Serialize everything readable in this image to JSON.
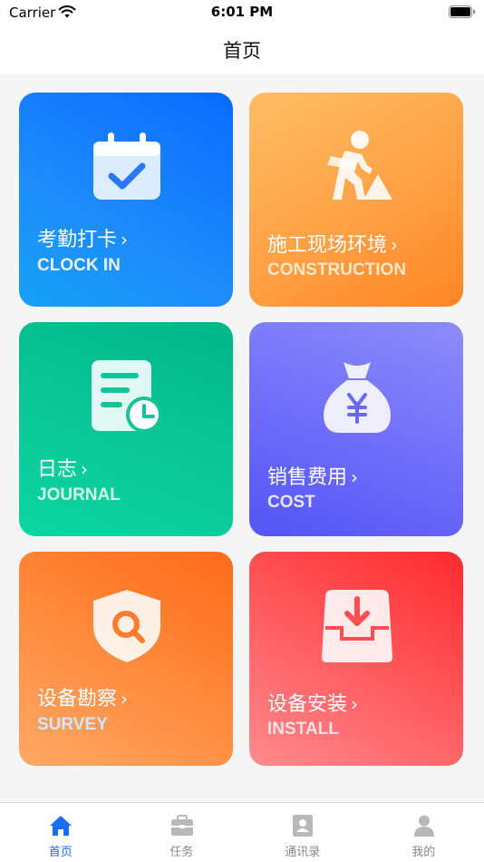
{
  "status_bar": {
    "carrier": "Carrier",
    "time": "6:01 PM",
    "icons": [
      "wifi-icon",
      "battery-icon"
    ]
  },
  "nav": {
    "title": "首页"
  },
  "cards": [
    {
      "title": "考勤打卡",
      "chevron": "›",
      "subtitle": "CLOCK IN",
      "subtitle_color": "#e8f2ff",
      "icon": "calendar-check-icon"
    },
    {
      "title": "施工现场环境",
      "chevron": "›",
      "subtitle": "CONSTRUCTION",
      "subtitle_color": "#ffe8c8",
      "icon": "construction-worker-icon"
    },
    {
      "title": "日志",
      "chevron": "›",
      "subtitle": "JOURNAL",
      "subtitle_color": "#d4f7ea",
      "icon": "journal-clock-icon"
    },
    {
      "title": "销售费用",
      "chevron": "›",
      "subtitle": "COST",
      "subtitle_color": "#e6e6ff",
      "icon": "money-bag-icon"
    },
    {
      "title": "设备勘察",
      "chevron": "›",
      "subtitle": "SURVEY",
      "subtitle_color": "#cfe8ff",
      "icon": "shield-search-icon"
    },
    {
      "title": "设备安装",
      "chevron": "›",
      "subtitle": "INSTALL",
      "subtitle_color": "#ffe1e1",
      "icon": "download-tray-icon"
    }
  ],
  "tabs": [
    {
      "label": "首页",
      "icon": "home-icon",
      "active": true
    },
    {
      "label": "任务",
      "icon": "briefcase-icon",
      "active": false
    },
    {
      "label": "通讯录",
      "icon": "contacts-icon",
      "active": false
    },
    {
      "label": "我的",
      "icon": "person-icon",
      "active": false
    }
  ],
  "colors": {
    "accent": "#1a6ef5",
    "tab_inactive": "#888888",
    "background": "#f5f5f5"
  }
}
